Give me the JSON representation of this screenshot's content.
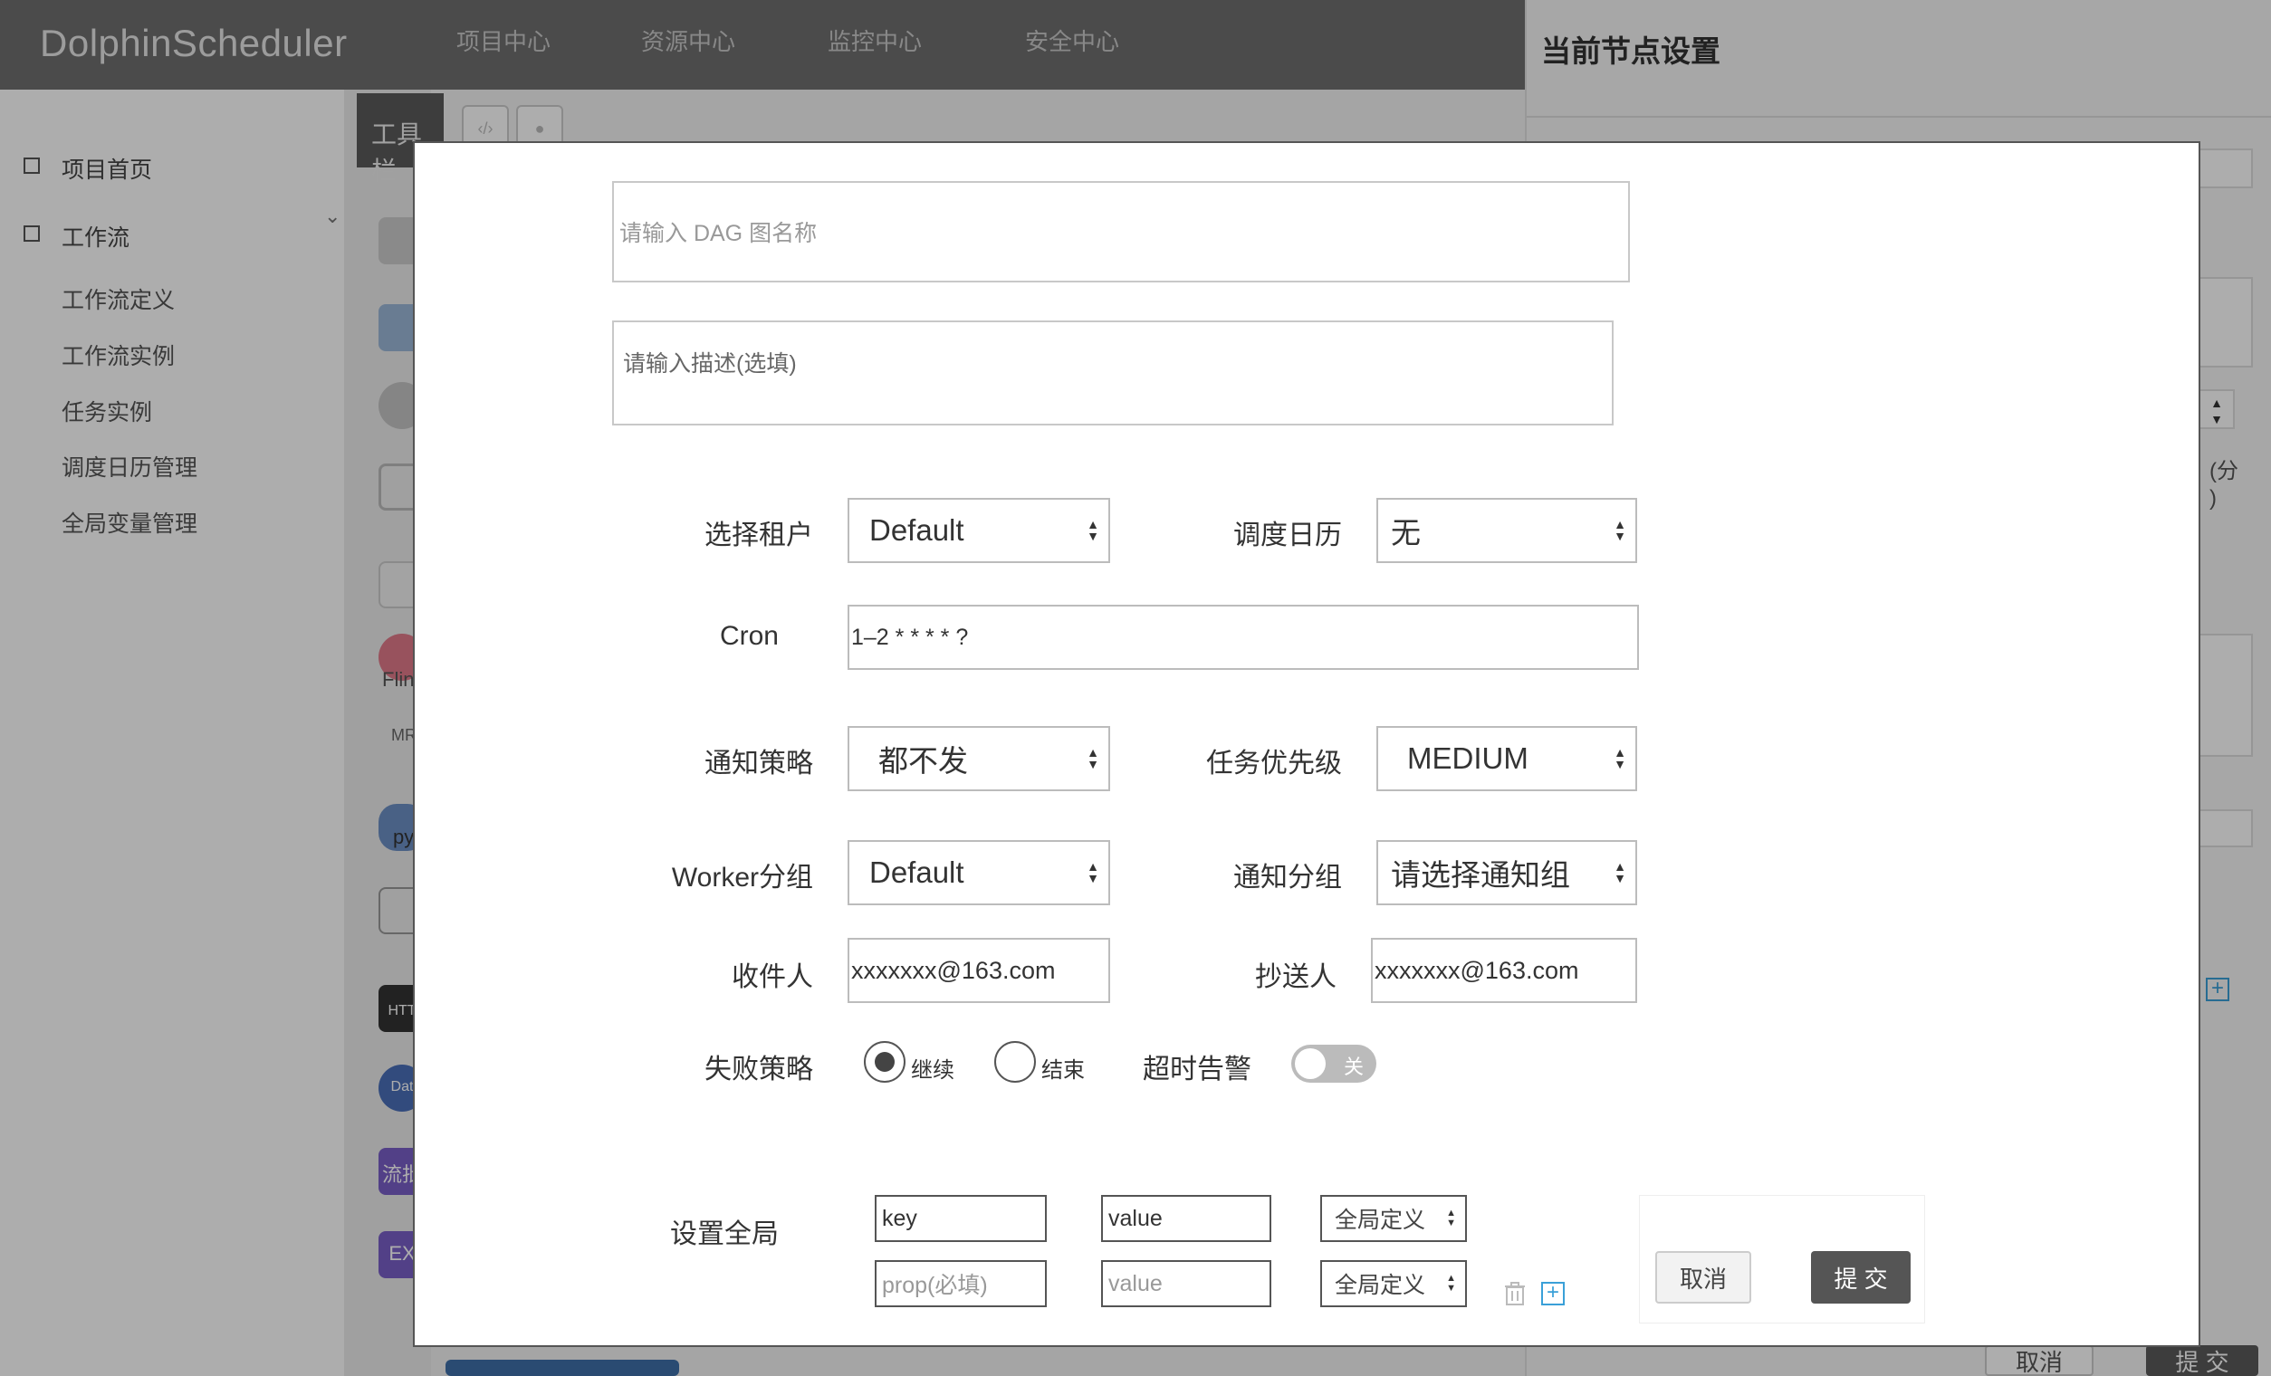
{
  "app": {
    "logo": "DolphinScheduler",
    "nav": [
      "项目中心",
      "资源中心",
      "监控中心",
      "安全中心"
    ]
  },
  "sidebar": {
    "home": "项目首页",
    "workflow": "工作流",
    "items": [
      "工作流定义",
      "工作流实例",
      "任务实例",
      "调度日历管理",
      "全局变量管理"
    ]
  },
  "toolbar": {
    "label": "工具栏"
  },
  "palette": {
    "labels": [
      "Flin",
      "MR",
      "py",
      "HTT",
      "Dat",
      "流批",
      "EX"
    ]
  },
  "right_panel": {
    "title": "当前节点设置",
    "unit": "(分\n)",
    "cancel": "取消",
    "submit": "提 交"
  },
  "modal": {
    "name_placeholder": "请输入 DAG 图名称",
    "desc_placeholder": "请输入描述(选填)",
    "tenant": {
      "label": "选择租户",
      "value": "Default"
    },
    "calendar": {
      "label": "调度日历",
      "value": "无"
    },
    "cron": {
      "label": "Cron",
      "value": "1–2 * * * * ?"
    },
    "notify_strategy": {
      "label": "通知策略",
      "value": "都不发"
    },
    "priority": {
      "label": "任务优先级",
      "value": "MEDIUM"
    },
    "worker_group": {
      "label": "Worker分组",
      "value": "Default"
    },
    "notify_group": {
      "label": "通知分组",
      "value": "请选择通知组"
    },
    "receivers": {
      "label": "收件人",
      "value": "xxxxxxx@163.com"
    },
    "cc": {
      "label": "抄送人",
      "value": "xxxxxxx@163.com"
    },
    "failure": {
      "label": "失败策略",
      "options": [
        "继续",
        "结束"
      ],
      "selected": "继续"
    },
    "timeout": {
      "label": "超时告警",
      "state": "关"
    },
    "globals": {
      "label": "设置全局",
      "rows": [
        {
          "key": "key",
          "value": "value",
          "type": "全局定义"
        },
        {
          "key_placeholder": "prop(必填)",
          "value_placeholder": "value",
          "type": "全局定义"
        }
      ]
    },
    "cancel": "取消",
    "submit": "提 交"
  },
  "colors": {
    "topbar": "#6f6f6f",
    "primary_button": "#5a5a5a",
    "add_icon": "#3aa0d8"
  }
}
